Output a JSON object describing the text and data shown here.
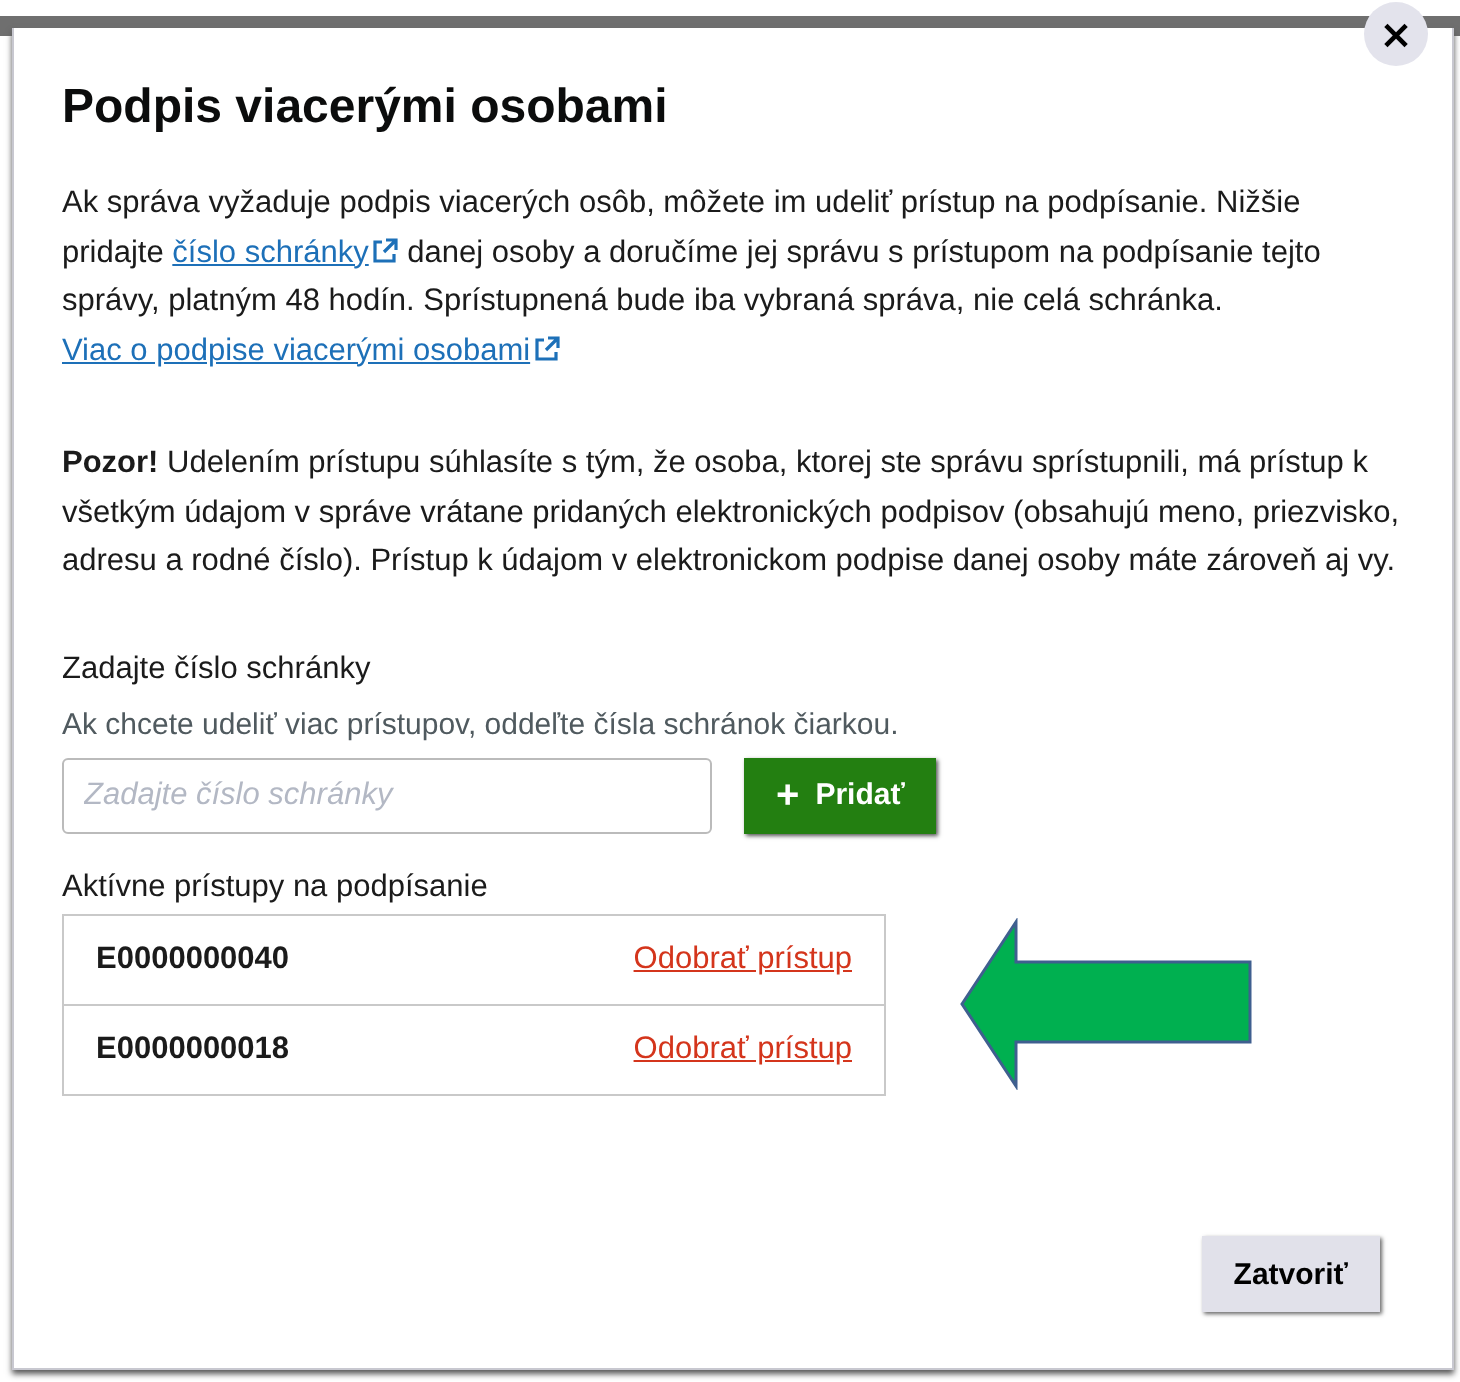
{
  "dialog": {
    "title": "Podpis viacerými osobami",
    "close": "×",
    "intro": [
      {
        "kind": "text",
        "text": "Ak správa vyžaduje podpis viacerých osôb, môžete im udeliť prístup na podpísanie. Nižšie pridajte "
      },
      {
        "kind": "link",
        "text": "číslo schránky"
      },
      {
        "kind": "text",
        "text": " danej osoby a doručíme jej správu s prístupom na podpísanie tejto správy, platným 48 hodín. Sprístupnená bude iba vybraná správa, nie celá schránka. "
      },
      {
        "kind": "link",
        "text": "Viac o podpise viacerými osobami"
      }
    ],
    "warning": "**Pozor!** Udelením prístupu súhlasíte s tým, že osoba, ktorej ste správu sprístupnili, má prístup k všetkým údajom v správe vrátane pridaných elektronických podpisov (obsahujú meno, priezvisko, adresu a rodné číslo). Prístup k údajom v elektronickom podpise danej osoby máte zároveň aj vy.",
    "field": {
      "label": "Zadajte číslo schránky",
      "hint": "Ak chcete udeliť viac prístupov, oddeľte čísla schránok čiarkou.",
      "placeholder": "Zadajte číslo schránky"
    },
    "add_button": {
      "icon": "+",
      "label": "Pridať"
    },
    "access_list": {
      "title": "Aktívne prístupy na podpísanie",
      "rows": [
        {
          "id": "E0000000040",
          "action": "Odobrať prístup"
        },
        {
          "id": "E0000000018",
          "action": "Odobrať prístup"
        }
      ]
    },
    "close_button": "Zatvoriť"
  }
}
